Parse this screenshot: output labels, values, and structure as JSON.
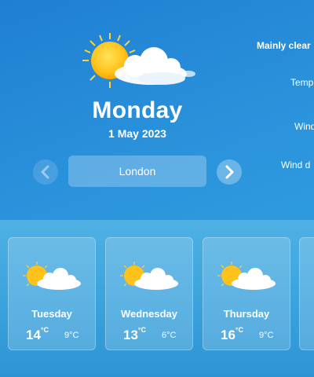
{
  "current": {
    "icon": "sun-cloud-icon",
    "day": "Monday",
    "date": "1 May 2023",
    "location": "London",
    "summary": "Mainly clear",
    "details": [
      "Temp",
      "Wind",
      "Wind d"
    ]
  },
  "navigation": {
    "prev_icon": "chevron-left-icon",
    "next_icon": "chevron-right-icon"
  },
  "forecast": [
    {
      "day": "Tuesday",
      "high": "14",
      "low": "9°C",
      "unit": "°C",
      "icon": "sun-cloud-icon"
    },
    {
      "day": "Wednesday",
      "high": "13",
      "low": "6°C",
      "unit": "°C",
      "icon": "sun-cloud-icon"
    },
    {
      "day": "Thursday",
      "high": "16",
      "low": "9°C",
      "unit": "°C",
      "icon": "sun-cloud-icon"
    }
  ],
  "colors": {
    "sun": "#ffc21a",
    "cloud": "#ffffff",
    "background": "#2b93dc"
  }
}
